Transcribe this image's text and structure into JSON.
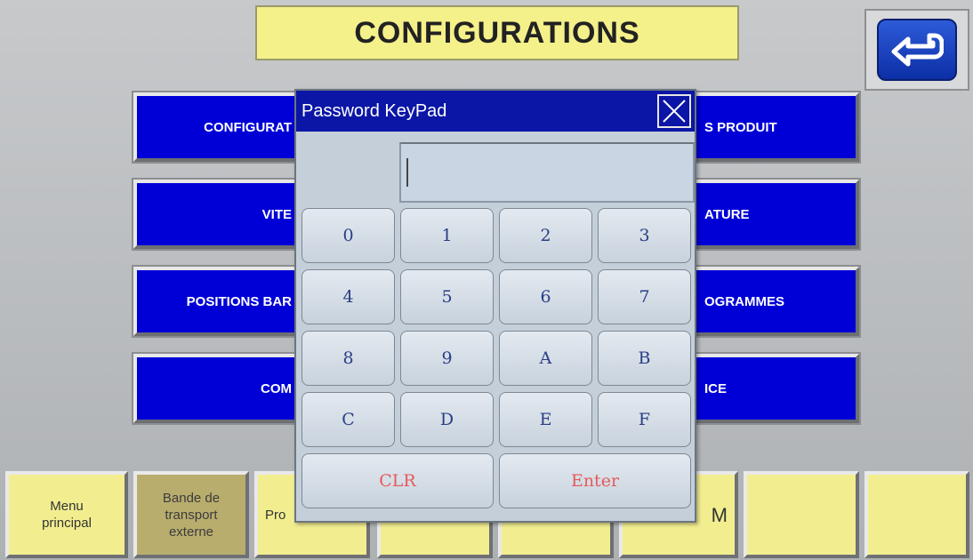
{
  "header": {
    "title": "CONFIGURATIONS"
  },
  "menu": {
    "left_items": [
      "CONFIGURAT",
      "VITE",
      "POSITIONS BAR",
      "COM"
    ],
    "right_items": [
      "S PRODUIT",
      "ATURE",
      "OGRAMMES",
      "ICE"
    ]
  },
  "bottom": {
    "items": [
      {
        "label": "Menu\nprincipal"
      },
      {
        "label": "Bande de\ntransport\nexterne"
      },
      {
        "label": "Pro"
      },
      {
        "label": ""
      },
      {
        "label": ""
      },
      {
        "label": "M"
      },
      {
        "label": ""
      },
      {
        "label": ""
      }
    ]
  },
  "keypad": {
    "title": "Password KeyPad",
    "input_value": "",
    "keys": [
      "0",
      "1",
      "2",
      "3",
      "4",
      "5",
      "6",
      "7",
      "8",
      "9",
      "A",
      "B",
      "C",
      "D",
      "E",
      "F"
    ],
    "clr_label": "CLR",
    "enter_label": "Enter"
  },
  "colors": {
    "menu_blue": "#0000d6",
    "title_yellow": "#f4f08a",
    "keypad_title": "#0b16a6",
    "action_text": "#e45a5a"
  },
  "icons": {
    "back": "return-arrow-icon",
    "close": "close-icon"
  }
}
